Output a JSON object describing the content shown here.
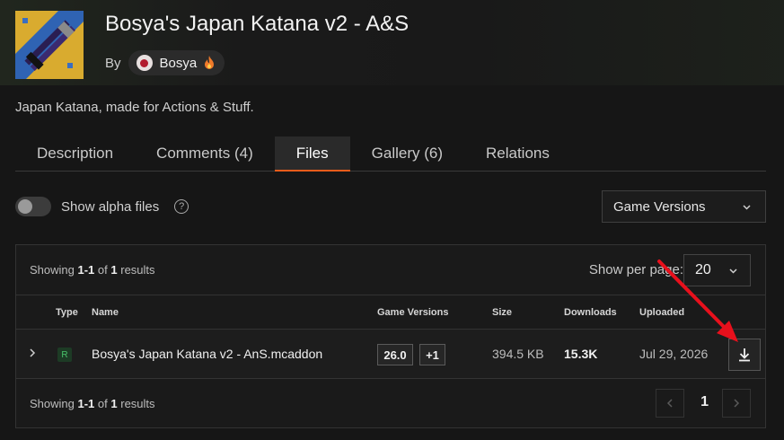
{
  "project": {
    "title": "Bosya's Japan Katana v2 - A&S",
    "by_label": "By",
    "author": "Bosya",
    "summary": "Japan Katana, made for Actions & Stuff."
  },
  "tabs": [
    {
      "label": "Description",
      "active": false
    },
    {
      "label": "Comments (4)",
      "active": false
    },
    {
      "label": "Files",
      "active": true
    },
    {
      "label": "Gallery (6)",
      "active": false
    },
    {
      "label": "Relations",
      "active": false
    }
  ],
  "filters": {
    "alpha_label": "Show alpha files",
    "help_glyph": "?",
    "game_versions_label": "Game Versions"
  },
  "results": {
    "showing_prefix": "Showing",
    "range": "1-1",
    "of": "of",
    "total": "1",
    "suffix": "results",
    "per_page_label": "Show per page:",
    "per_page_value": "20"
  },
  "table": {
    "columns": {
      "type": "Type",
      "name": "Name",
      "game_versions": "Game Versions",
      "size": "Size",
      "downloads": "Downloads",
      "uploaded": "Uploaded"
    },
    "rows": [
      {
        "type": "R",
        "name": "Bosya's Japan Katana v2 - AnS.mcaddon",
        "version": "26.0",
        "more_versions": "+1",
        "size": "394.5 KB",
        "downloads": "15.3K",
        "uploaded": "Jul 29, 2026"
      }
    ]
  },
  "pagination": {
    "current_page": "1"
  },
  "colors": {
    "accent": "#e85c1b",
    "annotation_arrow": "#e8101c",
    "release_badge": "#49c46a"
  }
}
